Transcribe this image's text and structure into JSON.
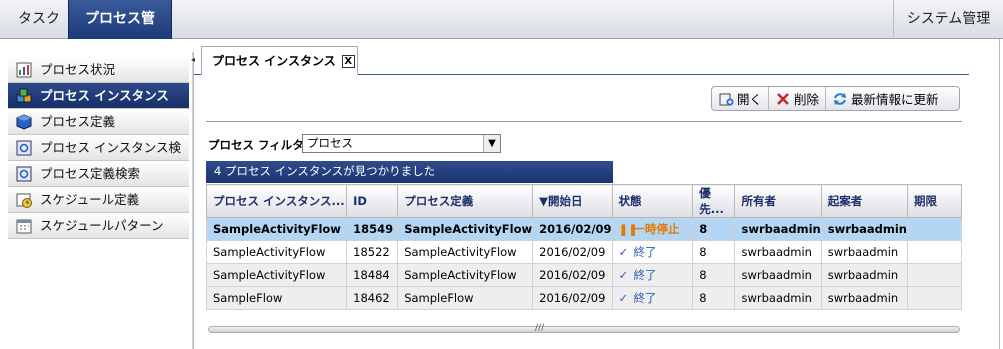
{
  "topbar": {
    "tabs": [
      {
        "label": "タスク"
      },
      {
        "label": "プロセス管理"
      }
    ],
    "system_label": "システム管理"
  },
  "sidebar": {
    "items": [
      {
        "label": "プロセス状況",
        "icon": "chart-icon"
      },
      {
        "label": "プロセス インスタンス",
        "icon": "instances-icon",
        "active": true
      },
      {
        "label": "プロセス定義",
        "icon": "cube-icon"
      },
      {
        "label": "プロセス インスタンス検索",
        "icon": "search-window-icon"
      },
      {
        "label": "プロセス定義検索",
        "icon": "search-window-icon"
      },
      {
        "label": "スケジュール定義",
        "icon": "clock-icon"
      },
      {
        "label": "スケジュールパターン",
        "icon": "calendar-icon"
      }
    ]
  },
  "content_tab": {
    "label": "プロセス インスタンス",
    "close": "X"
  },
  "toolbar": {
    "open_label": "開く",
    "delete_label": "削除",
    "refresh_label": "最新情報に更新"
  },
  "filter": {
    "label": "プロセス フィルタ:",
    "value": "プロセス"
  },
  "found_text": "4 プロセス インスタンスが見つかりました",
  "table": {
    "columns": [
      "プロセス インスタンス...",
      "ID",
      "プロセス定義",
      "開始日",
      "状態",
      "優先...",
      "所有者",
      "起案者",
      "期限"
    ],
    "sort_marker": "▼",
    "rows": [
      {
        "name": "SampleActivityFlow",
        "id": "18549",
        "def": "SampleActivityFlow",
        "date": "2016/02/09",
        "status": "一時停止",
        "status_type": "paused",
        "priority": "8",
        "owner": "swrbaadmin",
        "creator": "swrbaadmin",
        "due": ""
      },
      {
        "name": "SampleActivityFlow",
        "id": "18522",
        "def": "SampleActivityFlow",
        "date": "2016/02/09",
        "status": "終了",
        "status_type": "done",
        "priority": "8",
        "owner": "swrbaadmin",
        "creator": "swrbaadmin",
        "due": ""
      },
      {
        "name": "SampleActivityFlow",
        "id": "18484",
        "def": "SampleActivityFlow",
        "date": "2016/02/09",
        "status": "終了",
        "status_type": "done",
        "priority": "8",
        "owner": "swrbaadmin",
        "creator": "swrbaadmin",
        "due": ""
      },
      {
        "name": "SampleFlow",
        "id": "18462",
        "def": "SampleFlow",
        "date": "2016/02/09",
        "status": "終了",
        "status_type": "done",
        "priority": "8",
        "owner": "swrbaadmin",
        "creator": "swrbaadmin",
        "due": ""
      }
    ]
  },
  "colors": {
    "accent": "#1c3a78",
    "selected_row": "#b5d6f2",
    "paused": "#e07a00",
    "done": "#2b5fb0"
  }
}
